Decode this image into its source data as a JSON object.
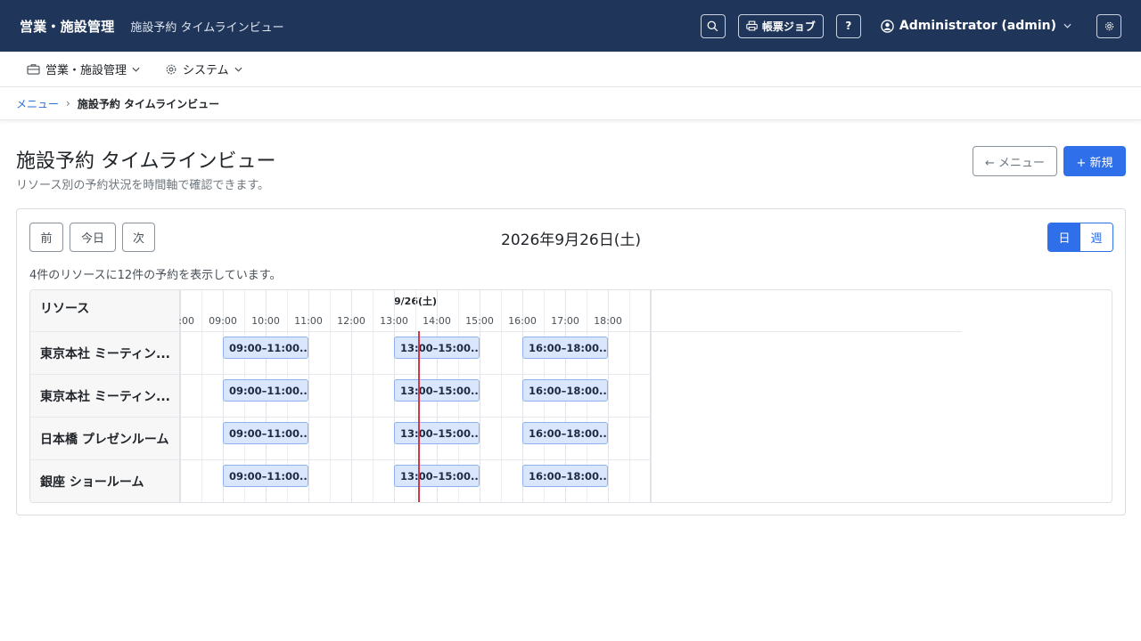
{
  "topbar": {
    "brand": "営業・施設管理",
    "subtitle": "施設予約 タイムラインビュー",
    "report_jobs_label": "帳票ジョブ",
    "help_label": "?",
    "user_label": "Administrator (admin)"
  },
  "menubar": {
    "items": [
      {
        "label": "営業・施設管理"
      },
      {
        "label": "システム"
      }
    ]
  },
  "breadcrumb": {
    "root": "メニュー",
    "current": "施設予約 タイムラインビュー"
  },
  "page": {
    "title": "施設予約 タイムラインビュー",
    "description": "リソース別の予約状況を時間軸で確認できます。",
    "back_label": "← メニュー",
    "new_label": "+ 新規"
  },
  "toolbar": {
    "prev_label": "前",
    "today_label": "今日",
    "next_label": "次",
    "date_heading": "2026年9月26日(土)",
    "view_day": "日",
    "view_week": "週"
  },
  "summary": "4件のリソースに12件の予約を表示しています。",
  "timeline": {
    "resource_header": "リソース",
    "day_label": "9/26(土)",
    "hours": [
      ":00",
      "09:00",
      "10:00",
      "11:00",
      "12:00",
      "13:00",
      "14:00",
      "15:00",
      "16:00",
      "17:00",
      "18:00"
    ],
    "resources": [
      {
        "name": "東京本社 ミーティン...",
        "bookings": [
          {
            "label": "09:00–11:00...",
            "start": "09:00",
            "end": "11:00"
          },
          {
            "label": "13:00–15:00...",
            "start": "13:00",
            "end": "15:00"
          },
          {
            "label": "16:00–18:00...",
            "start": "16:00",
            "end": "18:00"
          }
        ]
      },
      {
        "name": "東京本社 ミーティン...",
        "bookings": [
          {
            "label": "09:00–11:00...",
            "start": "09:00",
            "end": "11:00"
          },
          {
            "label": "13:00–15:00...",
            "start": "13:00",
            "end": "15:00"
          },
          {
            "label": "16:00–18:00...",
            "start": "16:00",
            "end": "18:00"
          }
        ]
      },
      {
        "name": "日本橋 プレゼンルーム",
        "bookings": [
          {
            "label": "09:00–11:00...",
            "start": "09:00",
            "end": "11:00"
          },
          {
            "label": "13:00–15:00...",
            "start": "13:00",
            "end": "15:00"
          },
          {
            "label": "16:00–18:00...",
            "start": "16:00",
            "end": "18:00"
          }
        ]
      },
      {
        "name": "銀座 ショールーム",
        "bookings": [
          {
            "label": "09:00–11:00...",
            "start": "09:00",
            "end": "11:00"
          },
          {
            "label": "13:00–15:00...",
            "start": "13:00",
            "end": "15:00"
          },
          {
            "label": "16:00–18:00...",
            "start": "16:00",
            "end": "18:00"
          }
        ]
      }
    ]
  },
  "colors": {
    "topbar_bg": "#1f3559",
    "primary": "#2f6fe9",
    "booking_bg": "#d9e6fb",
    "now_line": "#d0384b"
  }
}
